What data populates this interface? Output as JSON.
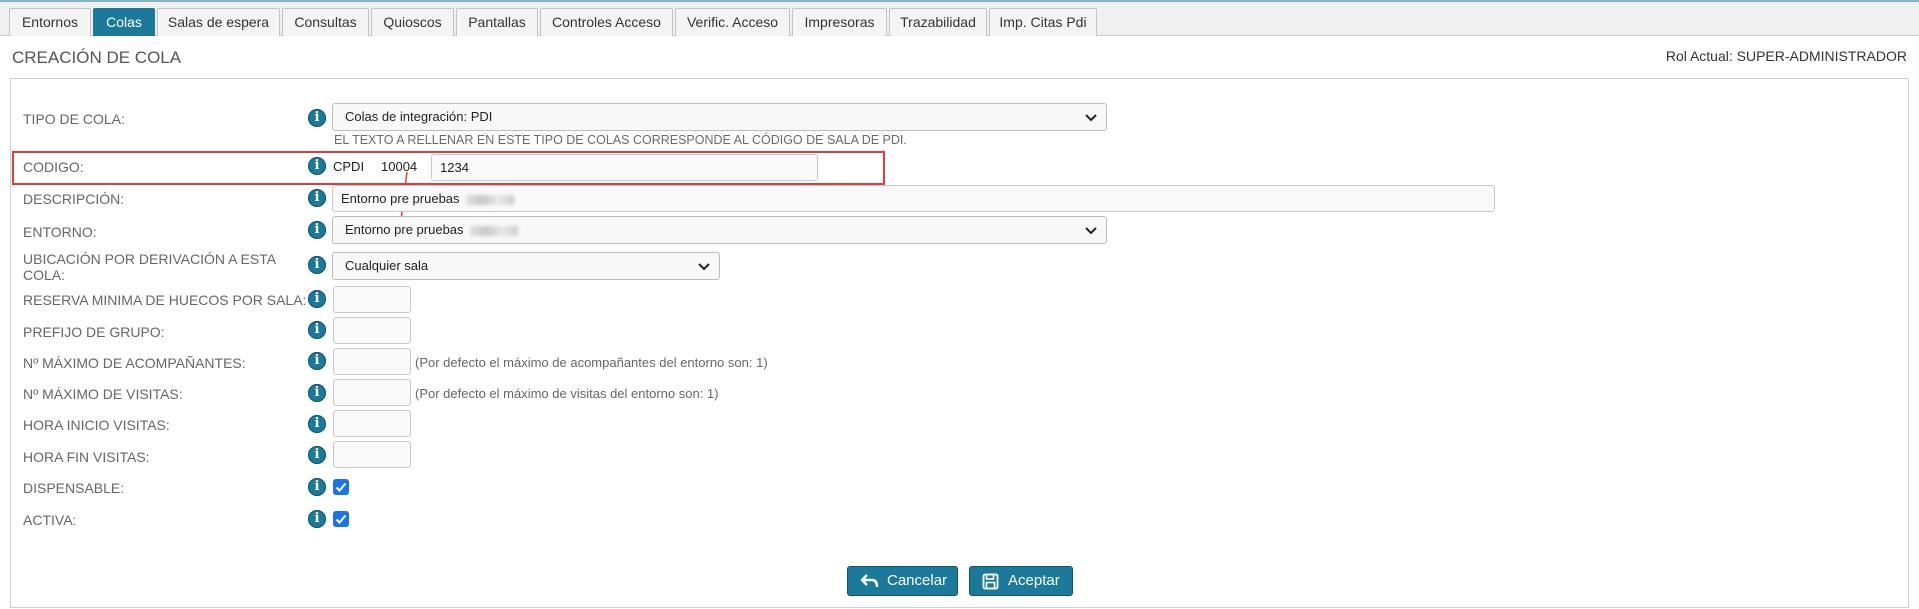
{
  "tabs": [
    {
      "label": "Entornos",
      "active": false
    },
    {
      "label": "Colas",
      "active": true
    },
    {
      "label": "Salas de espera",
      "active": false
    },
    {
      "label": "Consultas",
      "active": false
    },
    {
      "label": "Quioscos",
      "active": false
    },
    {
      "label": "Pantallas",
      "active": false
    },
    {
      "label": "Controles Acceso",
      "active": false
    },
    {
      "label": "Verific. Acceso",
      "active": false
    },
    {
      "label": "Impresoras",
      "active": false
    },
    {
      "label": "Trazabilidad",
      "active": false
    },
    {
      "label": "Imp. Citas Pdi",
      "active": false
    }
  ],
  "page": {
    "title": "CREACIÓN DE COLA",
    "role": "Rol Actual: SUPER-ADMINISTRADOR"
  },
  "form": {
    "tipo_cola": {
      "label": "TIPO DE COLA:",
      "value": "Colas de integración: PDI",
      "note": "EL TEXTO A RELLENAR EN ESTE TIPO DE COLAS CORRESPONDE AL CÓDIGO DE SALA DE PDI."
    },
    "codigo": {
      "label": "CODIGO:",
      "prefix": "CPDI",
      "code": "10004",
      "value": "1234"
    },
    "descripcion": {
      "label": "DESCRIPCIÓN:",
      "value": "Entorno pre pruebas"
    },
    "entorno": {
      "label": "ENTORNO:",
      "value": "Entorno pre pruebas"
    },
    "ubicacion": {
      "label_line1": "UBICACIÓN POR DERIVACIÓN A ESTA",
      "label_line2": "COLA:",
      "value": "Cualquier sala"
    },
    "reserva": {
      "label": "RESERVA MINIMA DE HUECOS POR SALA:",
      "value": ""
    },
    "prefijo": {
      "label": "PREFIJO DE GRUPO:",
      "value": ""
    },
    "acompanantes": {
      "label": "Nº MÁXIMO DE ACOMPAÑANTES:",
      "value": "",
      "note": "(Por defecto el máximo de acompañantes del entorno son: 1)"
    },
    "visitas": {
      "label": "Nº MÁXIMO DE VISITAS:",
      "value": "",
      "note": "(Por defecto el máximo de visitas del entorno son: 1)"
    },
    "hora_inicio": {
      "label": "HORA INICIO VISITAS:",
      "value": ""
    },
    "hora_fin": {
      "label": "HORA FIN VISITAS:",
      "value": ""
    },
    "dispensable": {
      "label": "DISPENSABLE:",
      "checked": true
    },
    "activa": {
      "label": "ACTIVA:",
      "checked": true
    }
  },
  "buttons": {
    "cancel": "Cancelar",
    "accept": "Aceptar"
  },
  "colors": {
    "accent": "#1b7a9c",
    "highlight": "#e23b3b",
    "checkbox": "#1a73e8"
  },
  "icons": [
    "info-icon",
    "chevron-down-icon",
    "undo-arrow-icon",
    "save-icon",
    "check-icon"
  ]
}
